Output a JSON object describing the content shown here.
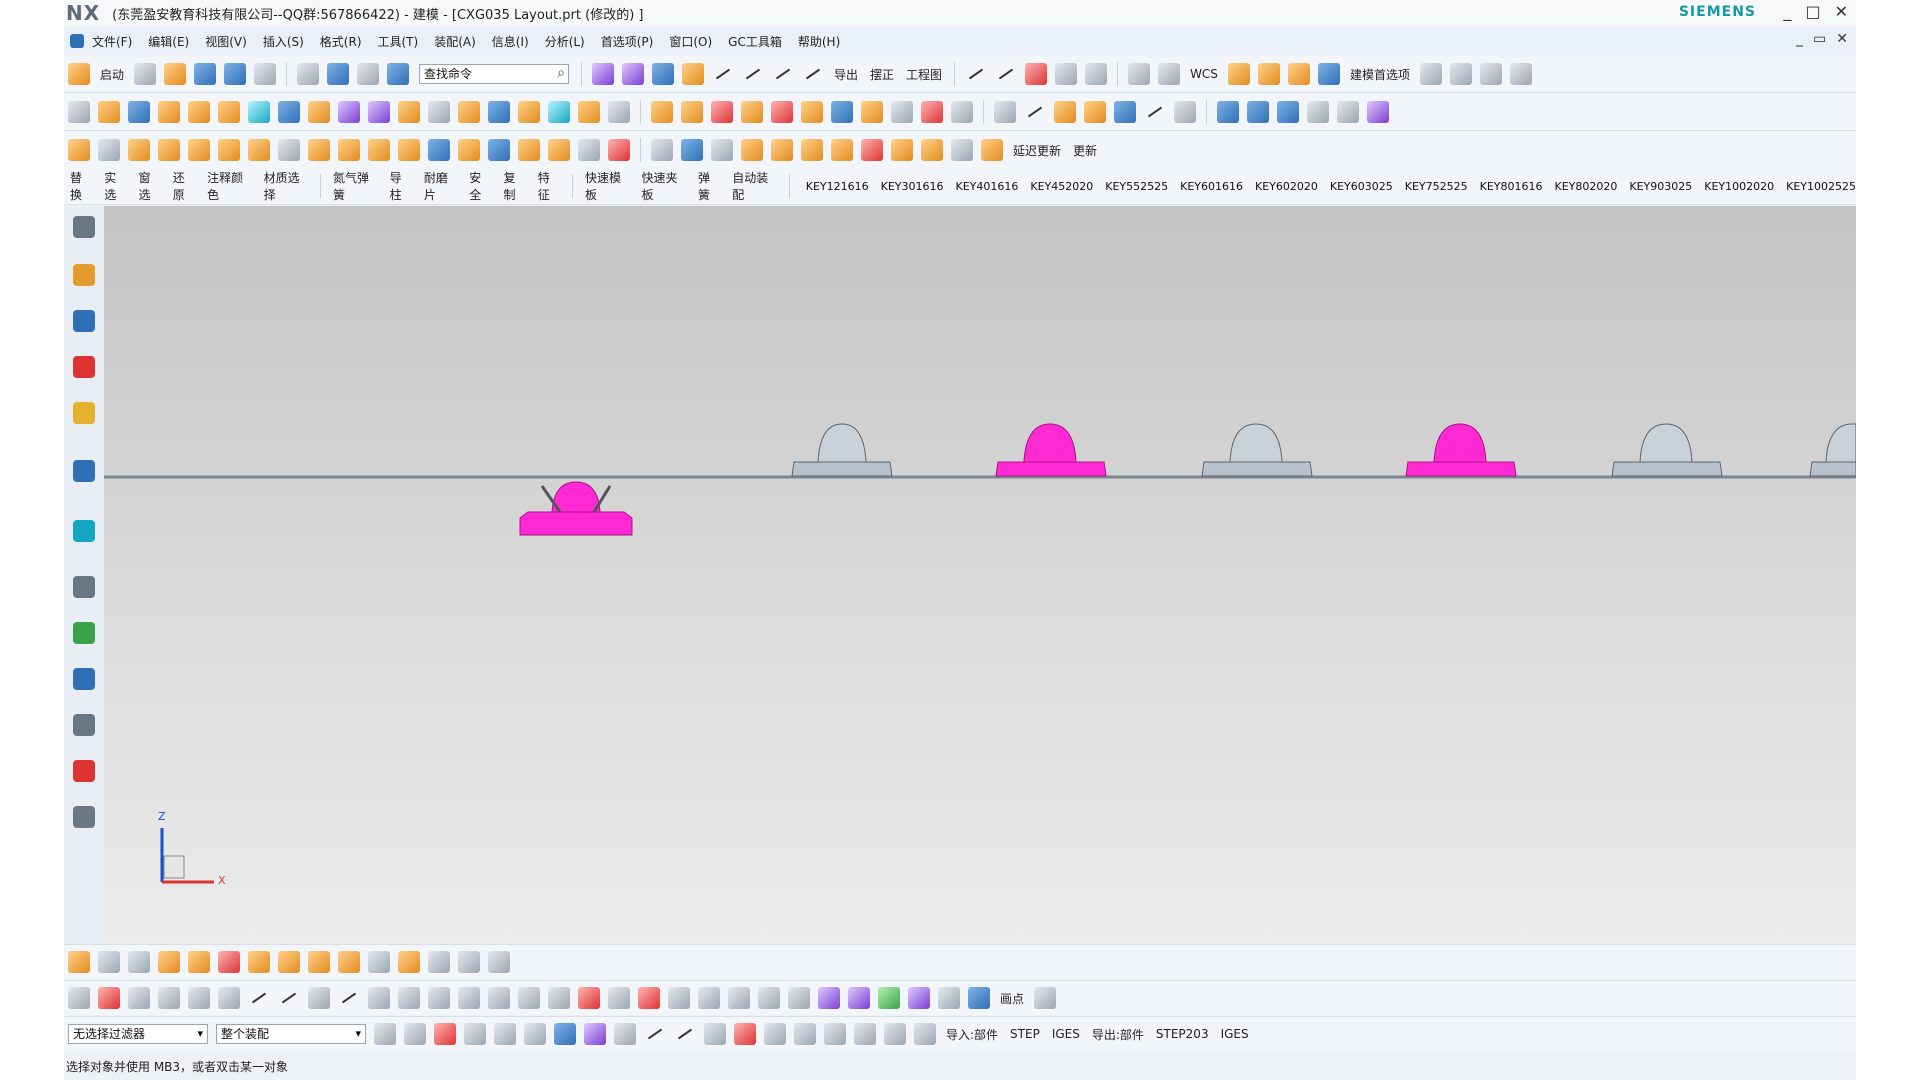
{
  "app": {
    "logo": "NX",
    "title": "(东莞盈安教育科技有限公司--QQ群:567866422) - 建模 - [CXG035 Layout.prt  (修改的) ]",
    "brand": "SIEMENS"
  },
  "window_controls": [
    "_",
    "□",
    "✕"
  ],
  "mdi_controls": [
    "_",
    "▭",
    "✕"
  ],
  "menu": [
    "文件(F)",
    "编辑(E)",
    "视图(V)",
    "插入(S)",
    "格式(R)",
    "工具(T)",
    "装配(A)",
    "信息(I)",
    "分析(L)",
    "首选项(P)",
    "窗口(O)",
    "GC工具箱",
    "帮助(H)"
  ],
  "toolbar1": {
    "start_label": "启动",
    "search_placeholder": "查找命令",
    "text_buttons": [
      "导出",
      "摆正",
      "工程图"
    ],
    "wcs_label": "WCS",
    "modeling_pref_label": "建模首选项"
  },
  "toolbar3": {
    "text_buttons": [
      "延迟更新",
      "更新"
    ]
  },
  "toolbar4": {
    "left_buttons": [
      "替换",
      "实选",
      "窗选",
      "还原",
      "注释颜色",
      "材质选择"
    ],
    "mid_buttons": [
      "氮气弹簧",
      "导柱",
      "耐磨片",
      "安全",
      "复制",
      "特征"
    ],
    "right_buttons": [
      "快速模板",
      "快速夹板",
      "弹簧",
      "自动装配"
    ],
    "keys": [
      "KEY121616",
      "KEY301616",
      "KEY401616",
      "KEY452020",
      "KEY552525",
      "KEY601616",
      "KEY602020",
      "KEY603025",
      "KEY752525",
      "KEY801616",
      "KEY802020",
      "KEY903025",
      "KEY1002020",
      "KEY1002525"
    ]
  },
  "viewport": {
    "background_top": "#c4c4c4",
    "background_bottom": "#ececec",
    "highlight_color": "#ff2ad4",
    "part_color": "#b8c2cc",
    "axis": {
      "z": "Z",
      "x": "X"
    }
  },
  "bottom": {
    "filter_select": "无选择过滤器",
    "scope_select": "整个装配",
    "sketch_label": "画点",
    "import_label": "导入:部件",
    "import_formats": [
      "STEP",
      "IGES"
    ],
    "export_label": "导出:部件",
    "export_formats": [
      "STEP203",
      "IGES"
    ]
  },
  "status": "选择对象并使用 MB3，或者双击某一对象",
  "icons": [
    "start-icon",
    "new-icon",
    "open-icon",
    "save-icon",
    "undo-icon",
    "redo-icon",
    "search-icon",
    "settings-icon"
  ]
}
